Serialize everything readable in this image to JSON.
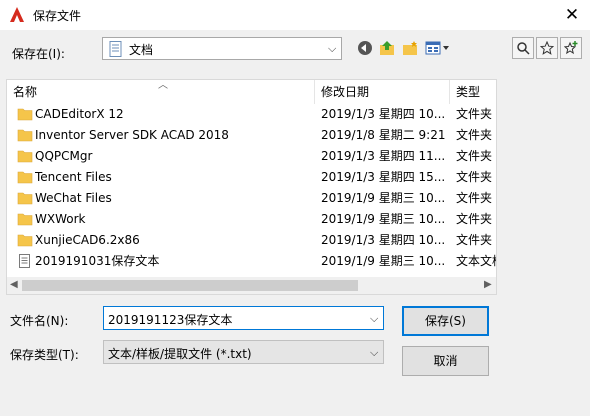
{
  "window": {
    "title": "保存文件",
    "close_glyph": "✕"
  },
  "location": {
    "label": "保存在(I):",
    "value": "文档"
  },
  "columns": {
    "name": "名称",
    "date": "修改日期",
    "type": "类型"
  },
  "files": [
    {
      "name": "CADEditorX 12",
      "date": "2019/1/3 星期四 10...",
      "type": "文件夹",
      "icon": "folder-icon"
    },
    {
      "name": "Inventor Server SDK ACAD 2018",
      "date": "2019/1/8 星期二 9:21",
      "type": "文件夹",
      "icon": "folder-icon"
    },
    {
      "name": "QQPCMgr",
      "date": "2019/1/3 星期四 11...",
      "type": "文件夹",
      "icon": "folder-icon"
    },
    {
      "name": "Tencent Files",
      "date": "2019/1/3 星期四 15...",
      "type": "文件夹",
      "icon": "folder-icon"
    },
    {
      "name": "WeChat Files",
      "date": "2019/1/9 星期三 10...",
      "type": "文件夹",
      "icon": "folder-icon"
    },
    {
      "name": "WXWork",
      "date": "2019/1/9 星期三 10...",
      "type": "文件夹",
      "icon": "folder-icon"
    },
    {
      "name": "XunjieCAD6.2x86",
      "date": "2019/1/3 星期四 10...",
      "type": "文件夹",
      "icon": "folder-icon"
    },
    {
      "name": "2019191031保存文本",
      "date": "2019/1/9 星期三 10...",
      "type": "文本文档",
      "icon": "text-file-icon"
    }
  ],
  "filename": {
    "label": "文件名(N):",
    "value": "2019191123保存文本"
  },
  "filetype": {
    "label": "保存类型(T):",
    "value": "文本/样板/提取文件 (*.txt)"
  },
  "buttons": {
    "save": "保存(S)",
    "cancel": "取消"
  },
  "colors": {
    "accent": "#0078d7",
    "folder": "#f5c54a",
    "app_icon": "#d52b1e"
  }
}
